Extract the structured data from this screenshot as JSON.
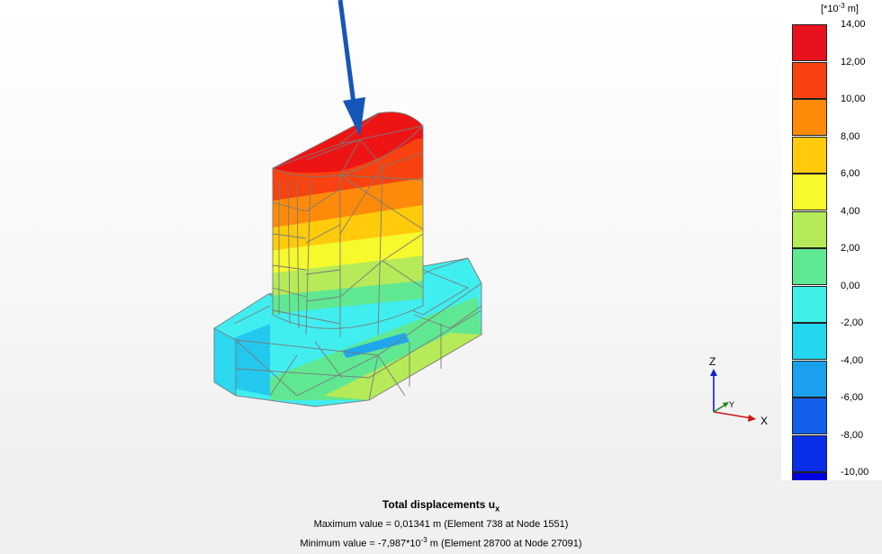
{
  "viewport": {
    "model_colors": {
      "band_14": "#e8121e",
      "band_12": "#f8420f",
      "band_10": "#ff8a0a",
      "band_8": "#ffcb0b",
      "band_6": "#f6f92b",
      "band_4": "#b6ea58",
      "band_2": "#5fe891",
      "band_0": "#3ff0e8",
      "band_m2": "#22d6f0",
      "band_m4": "#1aa0ec",
      "load_arrow": "#1457b8"
    },
    "axes": {
      "z": "Z",
      "y": "Y",
      "x": "X"
    }
  },
  "legend": {
    "unit_prefix": "[*10",
    "unit_exponent": "-3",
    "unit_suffix": " m]",
    "bands": [
      {
        "label": "14,00",
        "color": "#e8121e"
      },
      {
        "label": "12,00",
        "color": "#f8420f"
      },
      {
        "label": "10,00",
        "color": "#ff8a0a"
      },
      {
        "label": "8,00",
        "color": "#ffcb0b"
      },
      {
        "label": "6,00",
        "color": "#f6f92b"
      },
      {
        "label": "4,00",
        "color": "#b6ea58"
      },
      {
        "label": "2,00",
        "color": "#5fe891"
      },
      {
        "label": "0,00",
        "color": "#3ff0e8"
      },
      {
        "label": "-2,00",
        "color": "#22d6f0"
      },
      {
        "label": "-4,00",
        "color": "#1aa0ec"
      },
      {
        "label": "-6,00",
        "color": "#1560ea"
      },
      {
        "label": "-8,00",
        "color": "#0a2de8"
      },
      {
        "label": "-10,00",
        "color": "#0000e0"
      }
    ]
  },
  "footer": {
    "title": "Total displacements u",
    "title_sub": "x",
    "max_line": "Maximum value = 0,01341 m (Element 738 at Node 1551)",
    "min_prefix": "Minimum value = -7,987*10",
    "min_exponent": "-3",
    "min_suffix": " m (Element 28700 at Node 27091)"
  }
}
